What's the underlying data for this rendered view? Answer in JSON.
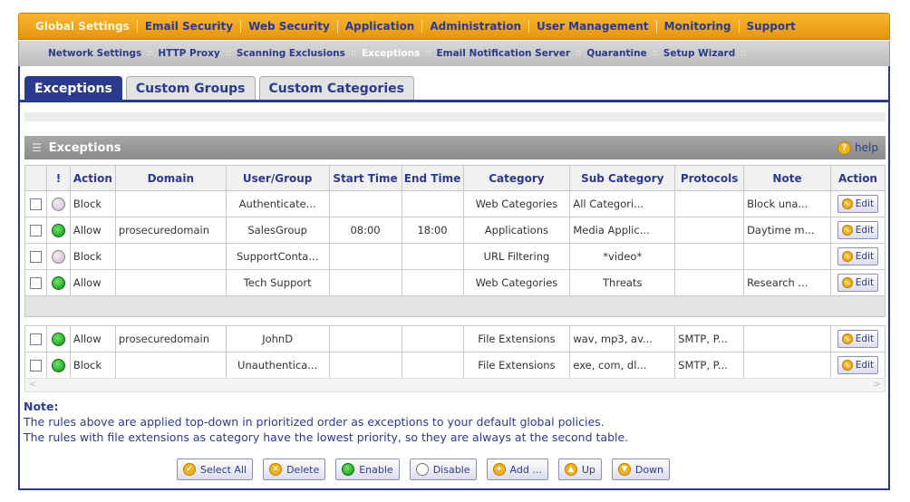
{
  "top_nav": [
    "Global Settings",
    "Email Security",
    "Web Security",
    "Application",
    "Administration",
    "User Management",
    "Monitoring",
    "Support"
  ],
  "sub_nav": [
    "Network Settings",
    "HTTP Proxy",
    "Scanning Exclusions",
    "Exceptions",
    "Email Notification Server",
    "Quarantine",
    "Setup Wizard"
  ],
  "tabs": [
    "Exceptions",
    "Custom Groups",
    "Custom Categories"
  ],
  "panel": {
    "title": "Exceptions",
    "help": "help"
  },
  "columns": [
    "!",
    "Action",
    "Domain",
    "User/Group",
    "Start Time",
    "End Time",
    "Category",
    "Sub Category",
    "Protocols",
    "Note",
    "Action"
  ],
  "rows_1": [
    {
      "enabled": false,
      "action": "Block",
      "domain": "",
      "user": "Authenticate...",
      "start": "",
      "end": "",
      "category": "Web Categories",
      "sub": "All Categori...",
      "protocols": "",
      "note": "Block una..."
    },
    {
      "enabled": true,
      "action": "Allow",
      "domain": "prosecuredomain",
      "user": "SalesGroup",
      "start": "08:00",
      "end": "18:00",
      "category": "Applications",
      "sub": "Media Applic...",
      "protocols": "",
      "note": "Daytime m..."
    },
    {
      "enabled": false,
      "action": "Block",
      "domain": "",
      "user": "SupportConta...",
      "start": "",
      "end": "",
      "category": "URL Filtering",
      "sub": "*video*",
      "protocols": "",
      "note": ""
    },
    {
      "enabled": true,
      "action": "Allow",
      "domain": "",
      "user": "Tech Support",
      "start": "",
      "end": "",
      "category": "Web Categories",
      "sub": "Threats",
      "protocols": "",
      "note": "Research ..."
    }
  ],
  "rows_2": [
    {
      "enabled": true,
      "action": "Allow",
      "domain": "prosecuredomain",
      "user": "JohnD",
      "start": "",
      "end": "",
      "category": "File Extensions",
      "sub": "wav, mp3, av...",
      "protocols": "SMTP, P...",
      "note": ""
    },
    {
      "enabled": true,
      "action": "Block",
      "domain": "",
      "user": "Unauthentica...",
      "start": "",
      "end": "",
      "category": "File Extensions",
      "sub": "exe, com, dl...",
      "protocols": "SMTP, P...",
      "note": ""
    }
  ],
  "edit_label": "Edit",
  "note": {
    "title": "Note:",
    "line1": "The rules above are applied top-down in prioritized order as exceptions to your default global policies.",
    "line2": "The rules with file extensions as category have the lowest priority, so they are always at the second table."
  },
  "buttons": {
    "select_all": "Select All",
    "delete": "Delete",
    "enable": "Enable",
    "disable": "Disable",
    "add": "Add ...",
    "up": "Up",
    "down": "Down"
  }
}
